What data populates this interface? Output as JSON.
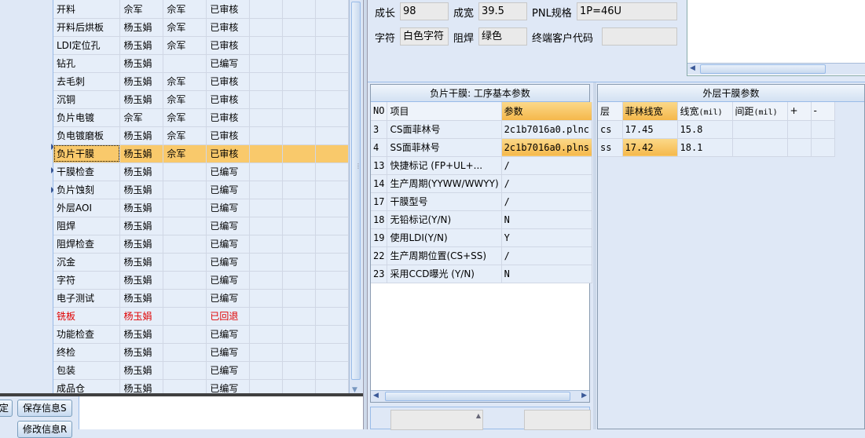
{
  "process_list": {
    "rows": [
      {
        "name": "开料",
        "author": "佘军",
        "reviewer": "佘军",
        "status": "已审核"
      },
      {
        "name": "开料后烘板",
        "author": "杨玉娟",
        "reviewer": "佘军",
        "status": "已审核"
      },
      {
        "name": "LDI定位孔",
        "author": "杨玉娟",
        "reviewer": "佘军",
        "status": "已审核"
      },
      {
        "name": "钻孔",
        "author": "杨玉娟",
        "reviewer": "",
        "status": "已编写"
      },
      {
        "name": "去毛刺",
        "author": "杨玉娟",
        "reviewer": "佘军",
        "status": "已审核"
      },
      {
        "name": "沉铜",
        "author": "杨玉娟",
        "reviewer": "佘军",
        "status": "已审核"
      },
      {
        "name": "负片电镀",
        "author": "佘军",
        "reviewer": "佘军",
        "status": "已审核"
      },
      {
        "name": "负电镀磨板",
        "author": "杨玉娟",
        "reviewer": "佘军",
        "status": "已审核"
      },
      {
        "name": "负片干膜",
        "author": "杨玉娟",
        "reviewer": "佘军",
        "status": "已审核",
        "selected": true
      },
      {
        "name": "干膜检查",
        "author": "杨玉娟",
        "reviewer": "",
        "status": "已编写"
      },
      {
        "name": "负片蚀刻",
        "author": "杨玉娟",
        "reviewer": "",
        "status": "已编写"
      },
      {
        "name": "外层AOI",
        "author": "杨玉娟",
        "reviewer": "",
        "status": "已编写"
      },
      {
        "name": "阻焊",
        "author": "杨玉娟",
        "reviewer": "",
        "status": "已编写"
      },
      {
        "name": "阻焊检查",
        "author": "杨玉娟",
        "reviewer": "",
        "status": "已编写"
      },
      {
        "name": "沉金",
        "author": "杨玉娟",
        "reviewer": "",
        "status": "已编写"
      },
      {
        "name": "字符",
        "author": "杨玉娟",
        "reviewer": "",
        "status": "已编写"
      },
      {
        "name": "电子测试",
        "author": "杨玉娟",
        "reviewer": "",
        "status": "已编写"
      },
      {
        "name": "铣板",
        "author": "杨玉娟",
        "reviewer": "",
        "status": "已回退",
        "alert": true
      },
      {
        "name": "功能检查",
        "author": "杨玉娟",
        "reviewer": "",
        "status": "已编写"
      },
      {
        "name": "终检",
        "author": "杨玉娟",
        "reviewer": "",
        "status": "已编写"
      },
      {
        "name": "包装",
        "author": "杨玉娟",
        "reviewer": "",
        "status": "已编写"
      },
      {
        "name": "成品仓",
        "author": "杨玉娟",
        "reviewer": "",
        "status": "已编写"
      }
    ],
    "alert_color": "#e00000",
    "selected_color": "#f9c96b"
  },
  "buttons": {
    "partial_left": "定",
    "save": "保存信息S",
    "modify": "修改信息R"
  },
  "board_info": {
    "cheng_chang_label": "成长",
    "cheng_chang_value": "98",
    "cheng_kuan_label": "成宽",
    "cheng_kuan_value": "39.5",
    "pnl_label": "PNL规格",
    "pnl_value": "1P=46U",
    "zifu_label": "字符",
    "zifu_value": "白色字符",
    "zuhan_label": "阻焊",
    "zuhan_value": "绿色",
    "customer_code_label": "终端客户代码",
    "customer_code_value": ""
  },
  "process_params": {
    "title": "负片干膜: 工序基本参数",
    "headers": {
      "no": "NO",
      "item": "项目",
      "param": "参数"
    },
    "rows": [
      {
        "no": "3",
        "item": "CS面菲林号",
        "param": "2c1b7016a0.plnc"
      },
      {
        "no": "4",
        "item": "SS面菲林号",
        "param": "2c1b7016a0.plns",
        "highlight": true
      },
      {
        "no": "13",
        "item": "快捷标记 (FP+UL+...",
        "param": "/"
      },
      {
        "no": "14",
        "item": "生产周期(YYWW/WWYY)",
        "param": "/"
      },
      {
        "no": "17",
        "item": "干膜型号",
        "param": "/"
      },
      {
        "no": "18",
        "item": "无铅标记(Y/N)",
        "param": "N"
      },
      {
        "no": "19",
        "item": "使用LDI(Y/N)",
        "param": "Y"
      },
      {
        "no": "22",
        "item": "生产周期位置(CS+SS)",
        "param": "/"
      },
      {
        "no": "23",
        "item": "采用CCD曝光 (Y/N)",
        "param": "N"
      }
    ]
  },
  "outer_dryfilm": {
    "title": "外层干膜参数",
    "headers": {
      "layer": "层",
      "film_width": "菲林线宽",
      "line_width": "线宽",
      "line_width_unit": "(mil)",
      "spacing": "间距",
      "spacing_unit": "(mil)",
      "plus": "+",
      "minus": "-"
    },
    "rows": [
      {
        "layer": "cs",
        "film_width": "17.45",
        "line_width": "15.8"
      },
      {
        "layer": "ss",
        "film_width": "17.42",
        "line_width": "18.1",
        "highlight": true
      }
    ]
  },
  "colors": {
    "bg": "#dfe8f6",
    "highlight": "#f5b84b",
    "grid_cell": "#e6eef9"
  }
}
